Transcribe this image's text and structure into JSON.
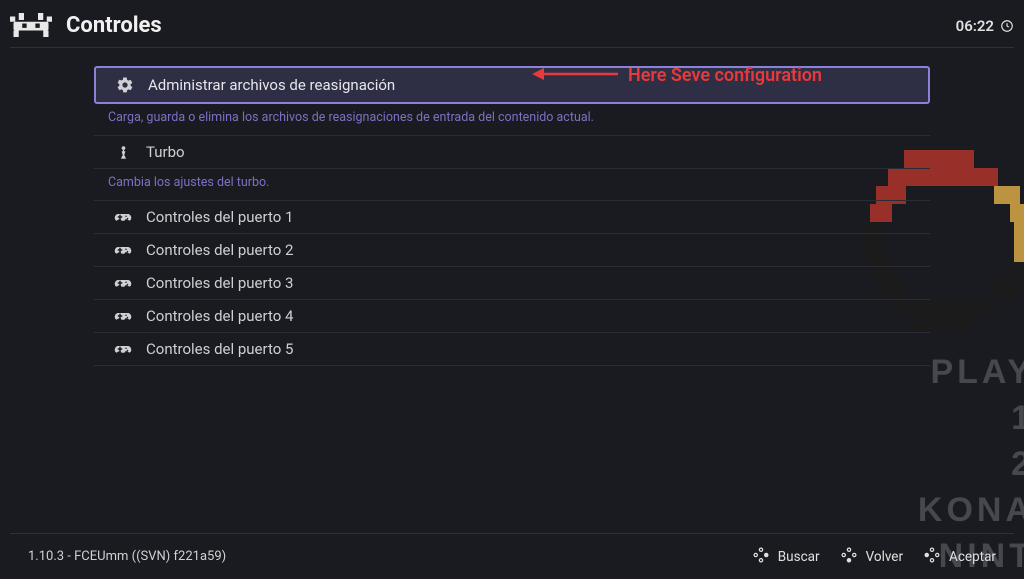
{
  "header": {
    "title": "Controles",
    "clock": "06:22"
  },
  "annotation": {
    "text": "Here Seve configuration"
  },
  "menu": {
    "item_manage": {
      "label": "Administrar archivos de reasignación",
      "hint": "Carga, guarda o elimina los archivos de reasignaciones de entrada del contenido actual."
    },
    "item_turbo": {
      "label": "Turbo",
      "hint": "Cambia los ajustes del turbo."
    },
    "ports": [
      {
        "label": "Controles del puerto 1"
      },
      {
        "label": "Controles del puerto 2"
      },
      {
        "label": "Controles del puerto 3"
      },
      {
        "label": "Controles del puerto 4"
      },
      {
        "label": "Controles del puerto 5"
      }
    ]
  },
  "footer": {
    "version": "1.10.3 - FCEUmm ((SVN) f221a59)",
    "buttons": {
      "search": "Buscar",
      "back": "Volver",
      "ok": "Aceptar"
    }
  },
  "bg": {
    "lines": [
      "PLAY",
      "1  ",
      "2  ",
      "KONA",
      "NINT"
    ]
  }
}
